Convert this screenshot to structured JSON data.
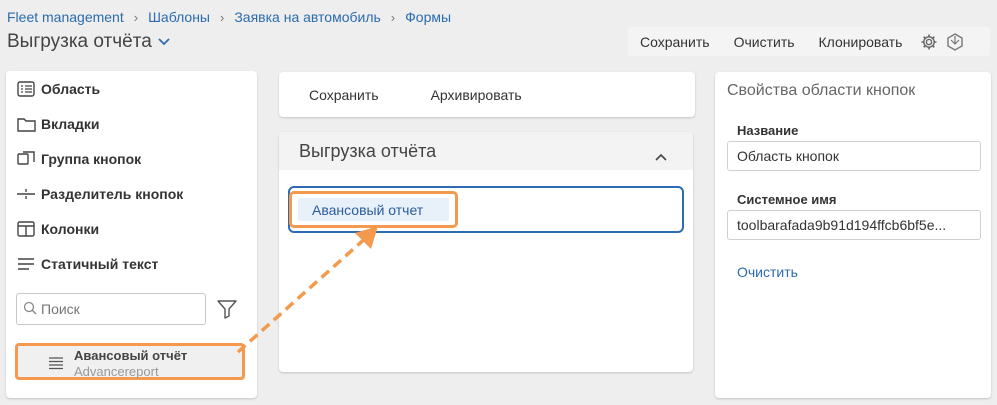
{
  "breadcrumbs": [
    "Fleet management",
    "Шаблоны",
    "Заявка на автомобиль",
    "Формы"
  ],
  "page_title": "Выгрузка отчёта",
  "toolbar": {
    "save": "Сохранить",
    "clear": "Очистить",
    "clone": "Клонировать",
    "icons": [
      "gear-icon",
      "hexagon-icon"
    ]
  },
  "palette": {
    "items": [
      {
        "label": "Область",
        "icon": "list-box-icon"
      },
      {
        "label": "Вкладки",
        "icon": "folder-icon"
      },
      {
        "label": "Группа кнопок",
        "icon": "button-group-icon"
      },
      {
        "label": "Разделитель кнопок",
        "icon": "divider-icon"
      },
      {
        "label": "Колонки",
        "icon": "columns-icon"
      },
      {
        "label": "Статичный текст",
        "icon": "text-lines-icon"
      }
    ],
    "search_placeholder": "Поиск",
    "dragged": {
      "title": "Авансовый отчёт",
      "system_name": "Advancereport"
    }
  },
  "canvas": {
    "top_buttons": [
      "Сохранить",
      "Архивировать"
    ],
    "section_title": "Выгрузка отчёта",
    "chip": "Авансовый отчет"
  },
  "properties": {
    "header": "Свойства области кнопок",
    "name_label": "Название",
    "name_value": "Область кнопок",
    "system_label": "Системное имя",
    "system_value": "toolbarafada9b91d194ffcb6bf5e...",
    "clear_link": "Очистить"
  },
  "colors": {
    "accent": "#2d6cb5",
    "highlight": "#f39a4e",
    "link": "#2b6cb0"
  }
}
